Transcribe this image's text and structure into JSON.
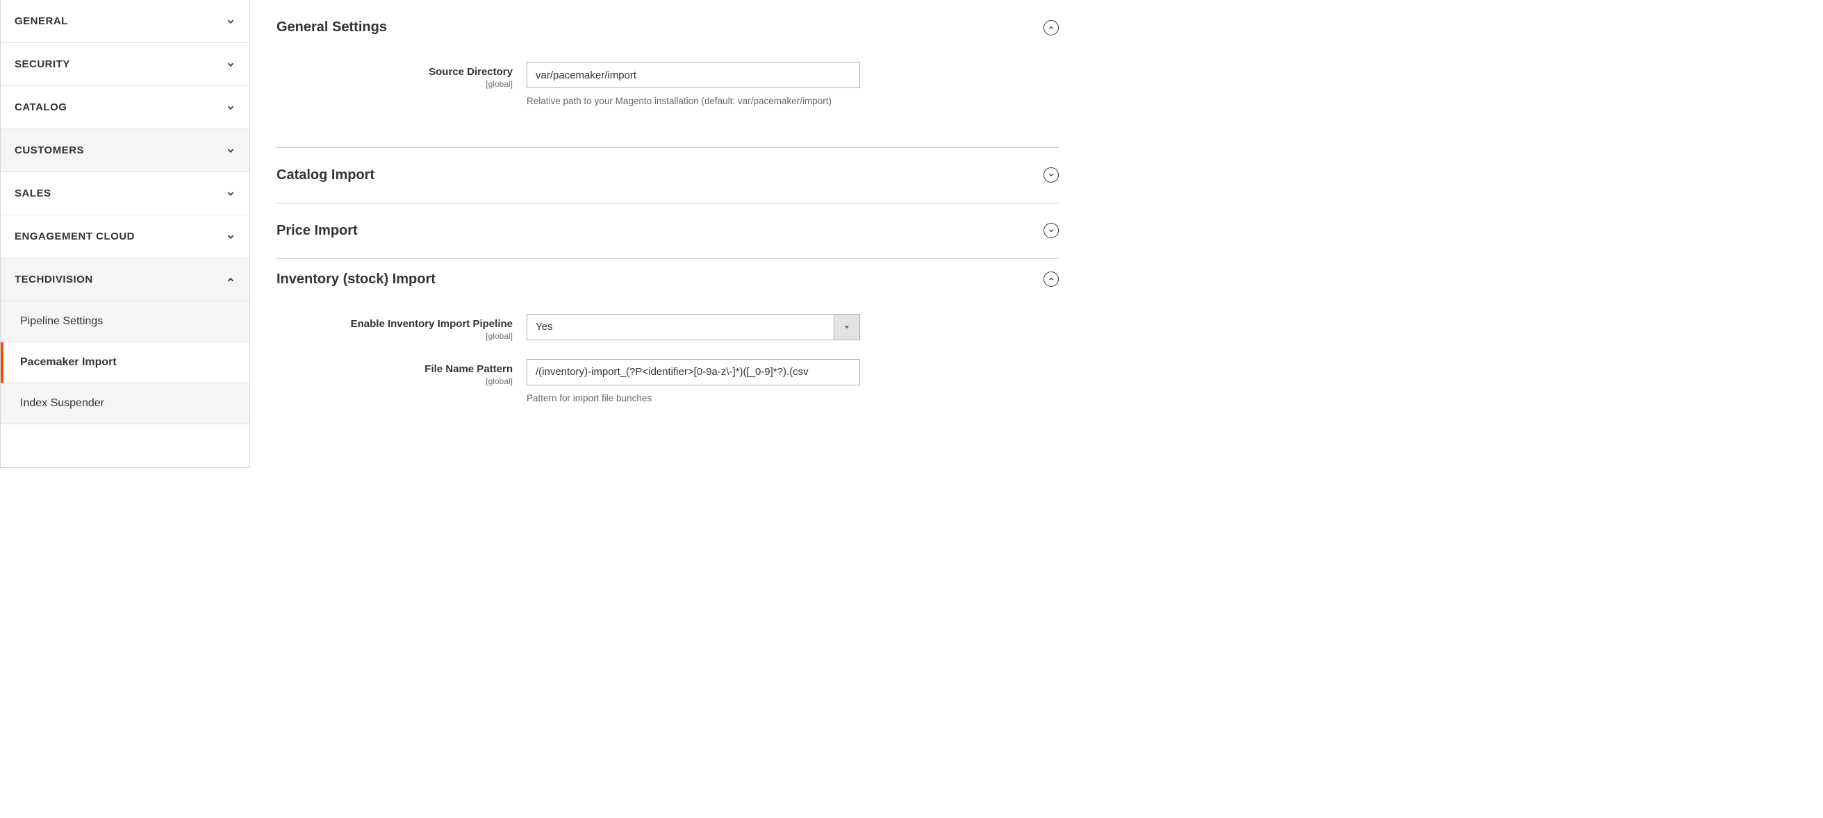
{
  "sidebar": {
    "items": [
      {
        "label": "GENERAL",
        "expanded": false,
        "section_bg": false
      },
      {
        "label": "SECURITY",
        "expanded": false,
        "section_bg": false
      },
      {
        "label": "CATALOG",
        "expanded": false,
        "section_bg": false
      },
      {
        "label": "CUSTOMERS",
        "expanded": false,
        "section_bg": true
      },
      {
        "label": "SALES",
        "expanded": false,
        "section_bg": false
      },
      {
        "label": "ENGAGEMENT CLOUD",
        "expanded": false,
        "section_bg": false
      },
      {
        "label": "TECHDIVISION",
        "expanded": true,
        "section_bg": true
      }
    ],
    "sub_items": [
      {
        "label": "Pipeline Settings",
        "active": false
      },
      {
        "label": "Pacemaker Import",
        "active": true
      },
      {
        "label": "Index Suspender",
        "active": false
      }
    ]
  },
  "sections": {
    "general": {
      "title": "General Settings",
      "fields": {
        "source_dir": {
          "label": "Source Directory",
          "scope": "[global]",
          "value": "var/pacemaker/import",
          "hint": "Relative path to your Magento installation (default: var/pacemaker/import)"
        }
      }
    },
    "catalog": {
      "title": "Catalog Import"
    },
    "price": {
      "title": "Price Import"
    },
    "inventory": {
      "title": "Inventory (stock) Import",
      "fields": {
        "enable": {
          "label": "Enable Inventory Import Pipeline",
          "scope": "[global]",
          "value": "Yes"
        },
        "pattern": {
          "label": "File Name Pattern",
          "scope": "[global]",
          "value": "/(inventory)-import_(?P<identifier>[0-9a-z\\-]*)([_0-9]*?).(csv",
          "hint": "Pattern for import file bunches"
        }
      }
    }
  }
}
